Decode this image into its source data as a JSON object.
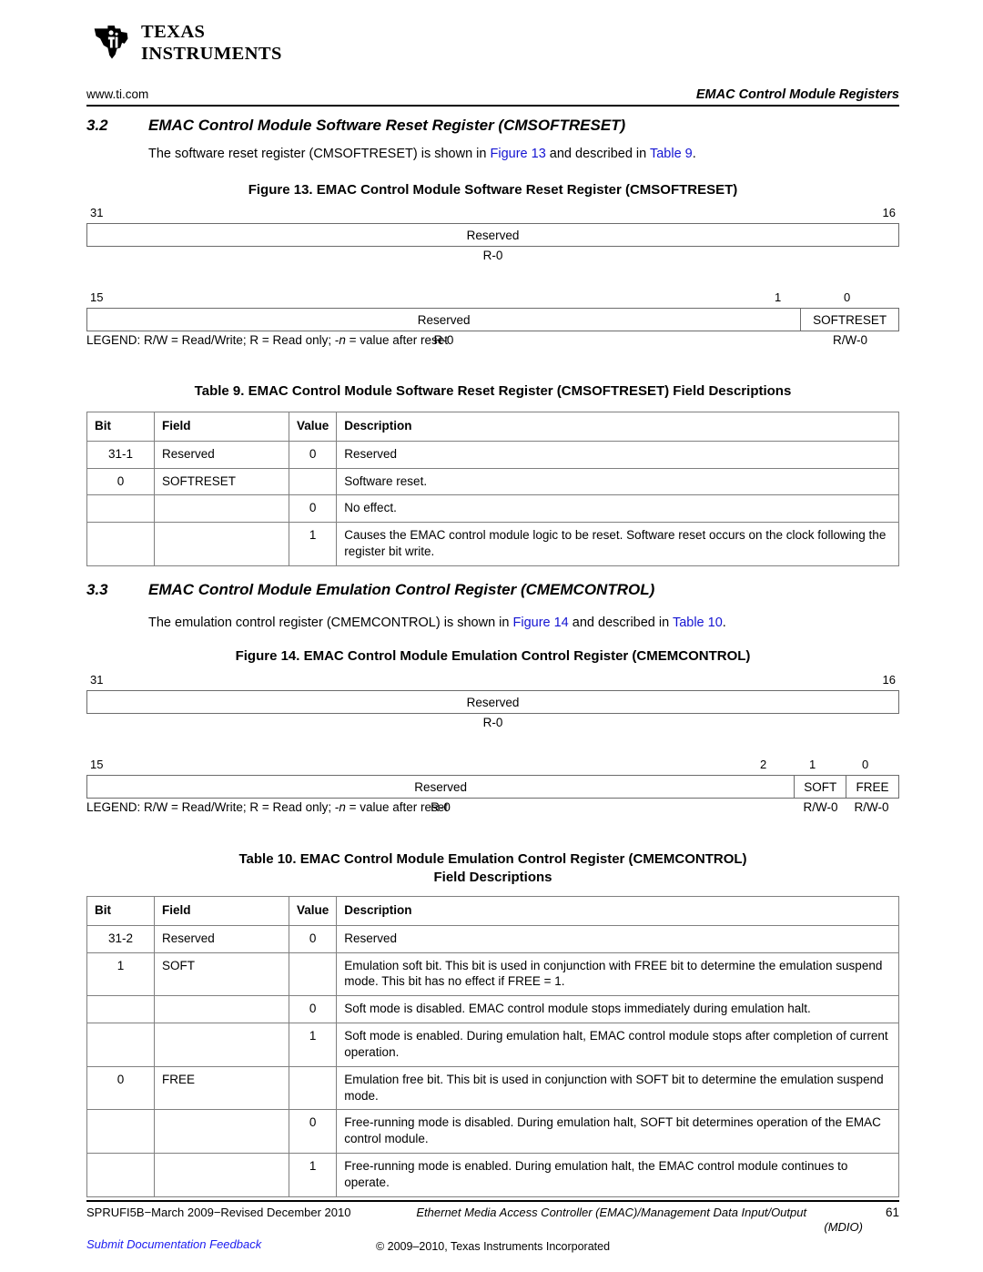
{
  "header": {
    "brand_line1": "TEXAS",
    "brand_line2": "INSTRUMENTS",
    "url": "www.ti.com",
    "running_head": "EMAC Control Module Registers"
  },
  "sections": [
    {
      "number": "3.2",
      "title": "EMAC Control Module Software Reset Register (CMSOFTRESET)",
      "intro_pre": "The software reset register (CMSOFTRESET) is shown in ",
      "intro_link1": "Figure 13",
      "intro_mid": " and described in ",
      "intro_link2": "Table 9",
      "intro_post": "."
    },
    {
      "number": "3.3",
      "title": "EMAC Control Module Emulation Control Register (CMEMCONTROL)",
      "intro_pre": "The emulation control register (CMEMCONTROL) is shown in ",
      "intro_link1": "Figure 14",
      "intro_mid": " and described in ",
      "intro_link2": "Table 10",
      "intro_post": "."
    }
  ],
  "figure13": {
    "caption": "Figure 13. EMAC Control Module Software Reset Register (CMSOFTRESET)",
    "row1": {
      "bit_left": "31",
      "bit_right": "16",
      "cells": [
        {
          "label": "Reserved"
        }
      ],
      "access": [
        {
          "label": "R-0"
        }
      ]
    },
    "row2": {
      "bit_left": "15",
      "bit_mid": "1",
      "bit_right": "0",
      "cells": [
        {
          "label": "Reserved"
        },
        {
          "label": "SOFTRESET"
        }
      ],
      "access": [
        {
          "label": "R-0"
        },
        {
          "label": "R/W-0"
        }
      ]
    },
    "legend_pre": "LEGEND: R/W = Read/Write; R = Read only; -",
    "legend_italic": "n",
    "legend_post": " = value after reset"
  },
  "figure14": {
    "caption": "Figure 14. EMAC Control Module Emulation Control Register (CMEMCONTROL)",
    "row1": {
      "bit_left": "31",
      "bit_right": "16",
      "cells": [
        {
          "label": "Reserved"
        }
      ],
      "access": [
        {
          "label": "R-0"
        }
      ]
    },
    "row2": {
      "bit_left": "15",
      "bit_2": "2",
      "bit_1": "1",
      "bit_0": "0",
      "cells": [
        {
          "label": "Reserved"
        },
        {
          "label": "SOFT"
        },
        {
          "label": "FREE"
        }
      ],
      "access": [
        {
          "label": "R-0"
        },
        {
          "label": "R/W-0"
        },
        {
          "label": "R/W-0"
        }
      ]
    },
    "legend_pre": "LEGEND: R/W = Read/Write; R = Read only; -",
    "legend_italic": "n",
    "legend_post": " = value after reset"
  },
  "table9": {
    "caption": "Table 9. EMAC Control Module Software Reset Register (CMSOFTRESET) Field Descriptions",
    "columns": [
      "Bit",
      "Field",
      "Value",
      "Description"
    ],
    "rows": [
      {
        "bit": "31-1",
        "field": "Reserved",
        "value": "0",
        "description": "Reserved"
      },
      {
        "bit": "0",
        "field": "SOFTRESET",
        "value": "",
        "description": "Software reset."
      },
      {
        "bit": "",
        "field": "",
        "value": "0",
        "description": "No effect."
      },
      {
        "bit": "",
        "field": "",
        "value": "1",
        "description": "Causes the EMAC control module logic to be reset. Software reset occurs on the clock following the register bit write."
      }
    ]
  },
  "table10": {
    "caption_line1": "Table 10. EMAC Control Module Emulation Control Register (CMEMCONTROL)",
    "caption_line2": "Field Descriptions",
    "columns": [
      "Bit",
      "Field",
      "Value",
      "Description"
    ],
    "rows": [
      {
        "bit": "31-2",
        "field": "Reserved",
        "value": "0",
        "description": "Reserved"
      },
      {
        "bit": "1",
        "field": "SOFT",
        "value": "",
        "description": "Emulation soft bit. This bit is used in conjunction with FREE bit to determine the emulation suspend mode. This bit has no effect if FREE = 1."
      },
      {
        "bit": "",
        "field": "",
        "value": "0",
        "description": "Soft mode is disabled. EMAC control module stops immediately during emulation halt."
      },
      {
        "bit": "",
        "field": "",
        "value": "1",
        "description": "Soft mode is enabled. During emulation halt, EMAC control module stops after completion of current operation."
      },
      {
        "bit": "0",
        "field": "FREE",
        "value": "",
        "description": "Emulation free bit. This bit is used in conjunction with SOFT bit to determine the emulation suspend mode."
      },
      {
        "bit": "",
        "field": "",
        "value": "0",
        "description": "Free-running mode is disabled. During emulation halt, SOFT bit determines operation of the EMAC control module."
      },
      {
        "bit": "",
        "field": "",
        "value": "1",
        "description": "Free-running mode is enabled. During emulation halt, the EMAC control module continues to operate."
      }
    ]
  },
  "footer": {
    "doc_id": "SPRUFI5B−March 2009−Revised December 2010",
    "title": "Ethernet Media Access Controller (EMAC)/Management Data Input/Output",
    "title_cont": "(MDIO)",
    "page": "61",
    "feedback": "Submit Documentation Feedback",
    "copyright": "© 2009–2010, Texas Instruments Incorporated"
  },
  "colors": {
    "link": "#1414d2",
    "rule": "#000000",
    "cell_border": "#6b6b6b",
    "table_border": "#808080"
  }
}
